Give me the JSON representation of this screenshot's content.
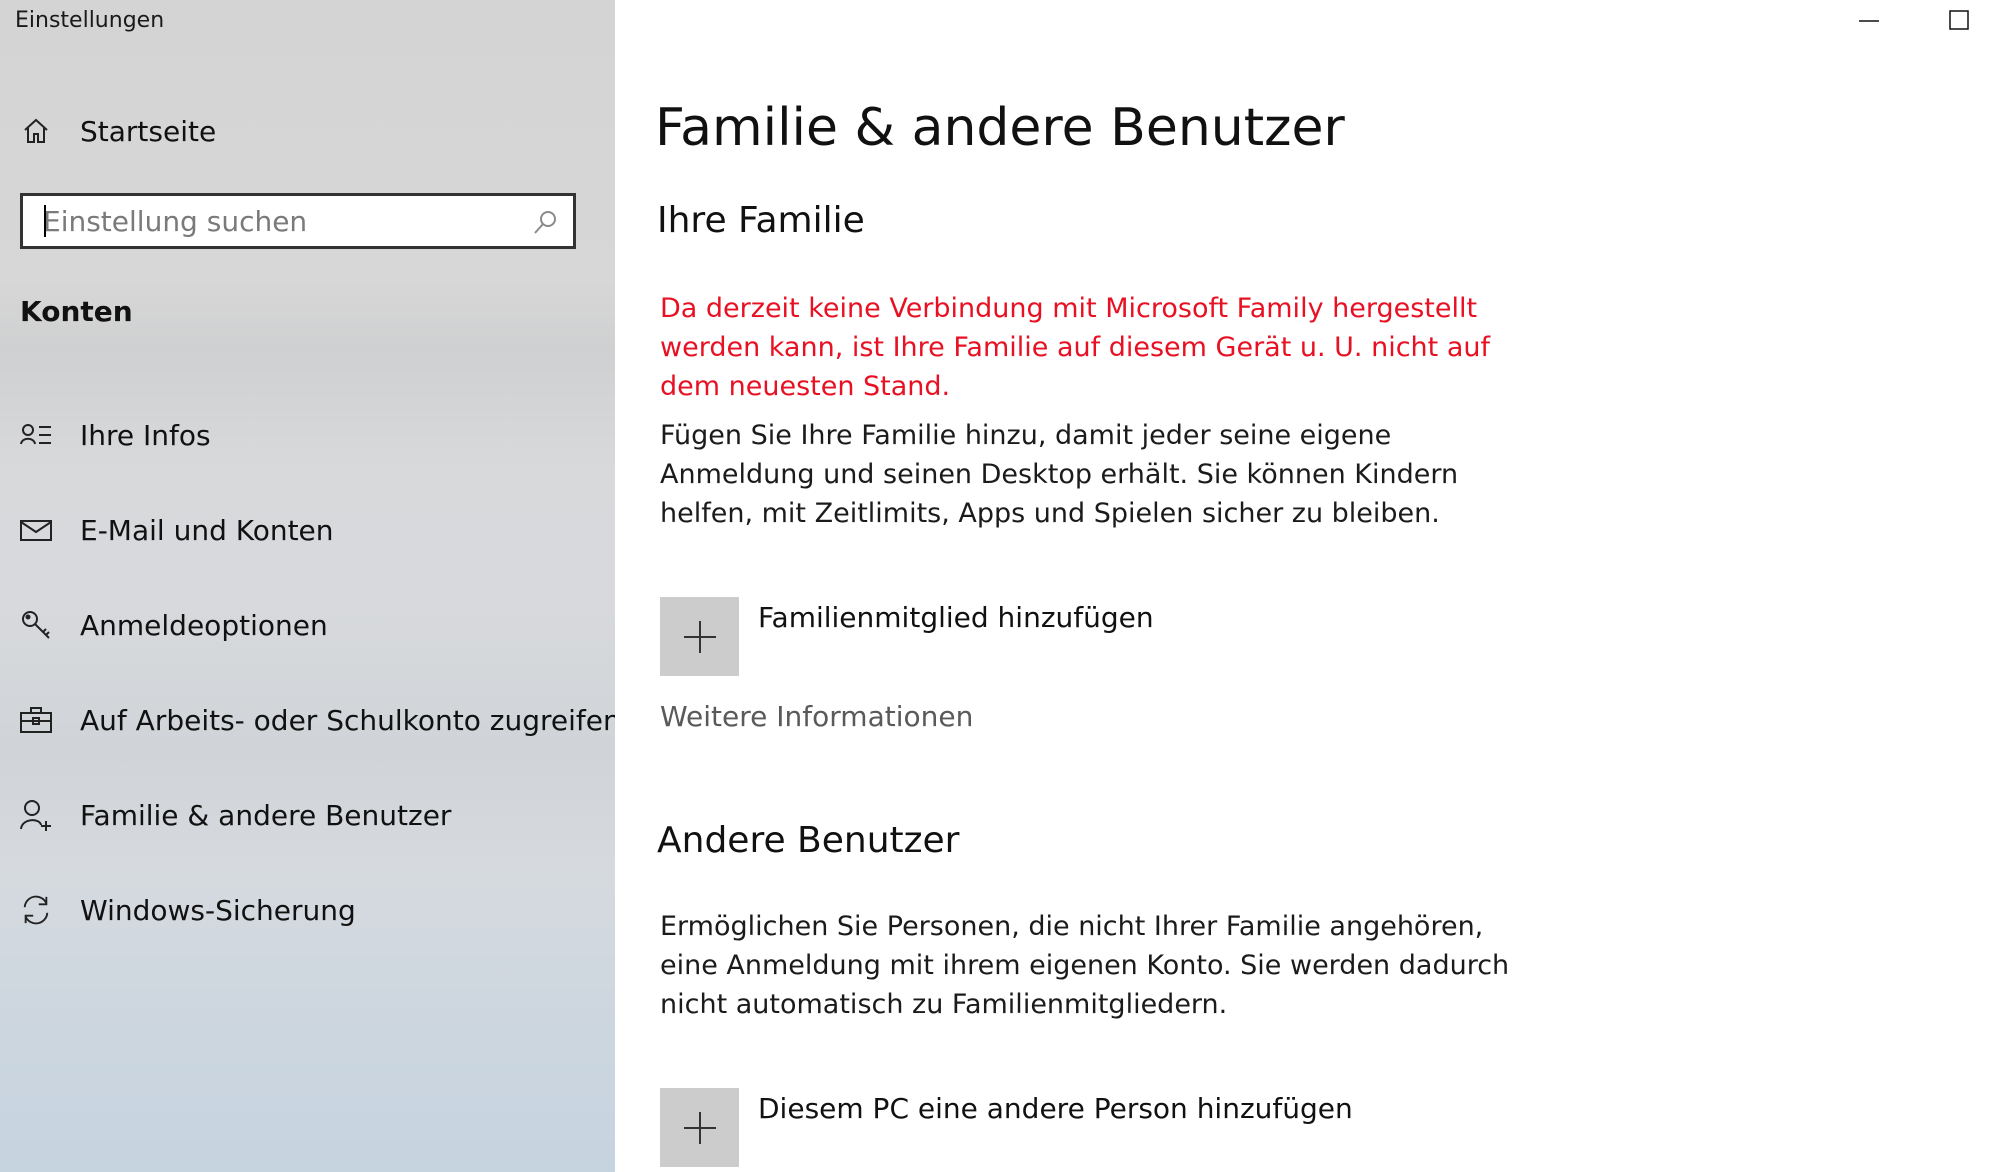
{
  "window": {
    "title": "Einstellungen"
  },
  "sidebar": {
    "home_label": "Startseite",
    "search_placeholder": "Einstellung suchen",
    "section_heading": "Konten",
    "items": [
      {
        "label": "Ihre Infos",
        "icon": "person-list-icon"
      },
      {
        "label": "E-Mail und Konten",
        "icon": "mail-icon"
      },
      {
        "label": "Anmeldeoptionen",
        "icon": "key-icon"
      },
      {
        "label": "Auf Arbeits- oder Schulkonto zugreifen",
        "icon": "briefcase-icon"
      },
      {
        "label": "Familie & andere Benutzer",
        "icon": "person-add-icon"
      },
      {
        "label": "Windows-Sicherung",
        "icon": "sync-icon"
      }
    ]
  },
  "main": {
    "page_title": "Familie & andere Benutzer",
    "family": {
      "heading": "Ihre Familie",
      "warning": "Da derzeit keine Verbindung mit Microsoft Family hergestellt werden kann, ist Ihre Familie auf diesem Gerät u. U. nicht auf dem neuesten Stand.",
      "description": "Fügen Sie Ihre Familie hinzu, damit jeder seine eigene Anmeldung und seinen Desktop erhält. Sie können Kindern helfen, mit Zeitlimits, Apps und Spielen sicher zu bleiben.",
      "add_label": "Familienmitglied hinzufügen",
      "more_info": "Weitere Informationen"
    },
    "others": {
      "heading": "Andere Benutzer",
      "description": "Ermöglichen Sie Personen, die nicht Ihrer Familie angehören, eine Anmeldung mit ihrem eigenen Konto. Sie werden dadurch nicht automatisch zu Familienmitgliedern.",
      "add_label": "Diesem PC eine andere Person hinzufügen"
    }
  },
  "colors": {
    "warning": "#e81123",
    "tile": "#cccccc"
  }
}
